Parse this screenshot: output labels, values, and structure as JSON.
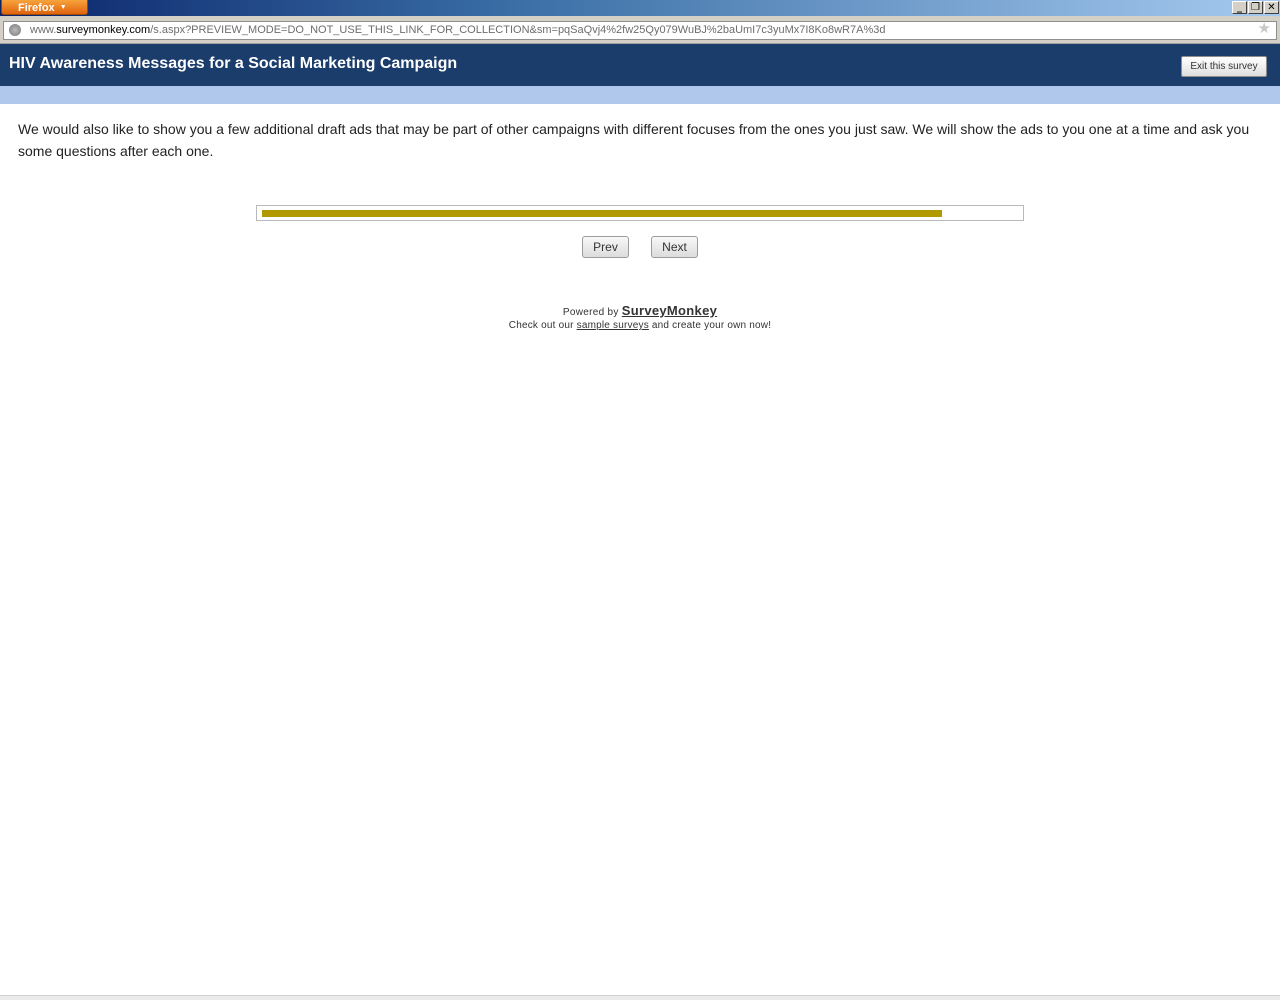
{
  "browser": {
    "app_button": "Firefox",
    "window_controls": {
      "minimize": "_",
      "restore": "❐",
      "close": "✕"
    },
    "url": {
      "prefix": "www.",
      "domain": "surveymonkey.com",
      "path": "/s.aspx?PREVIEW_MODE=DO_NOT_USE_THIS_LINK_FOR_COLLECTION&sm=pqSaQvj4%2fw25Qy079WuBJ%2baUmI7c3yuMx7I8Ko8wR7A%3d"
    },
    "bookmark_icon": "star-icon"
  },
  "survey": {
    "title": "HIV Awareness Messages for a Social Marketing Campaign",
    "exit_label": "Exit this survey",
    "intro": "We would also like to show you a few additional draft ads that may be part of other campaigns with different focuses from the ones you just saw. We will show the ads to you one at a time and ask you some questions after each one.",
    "progress": 0.9,
    "prev_label": "Prev",
    "next_label": "Next"
  },
  "footer": {
    "powered_by": "Powered by",
    "brand": "SurveyMonkey",
    "checkout_prefix": "Check out our",
    "sample_link": "sample surveys",
    "checkout_suffix": "and create your own now!"
  },
  "colors": {
    "header_bg": "#1b3d6b",
    "stripe": "#b0c8ec",
    "progress_fill": "#b19a00"
  }
}
